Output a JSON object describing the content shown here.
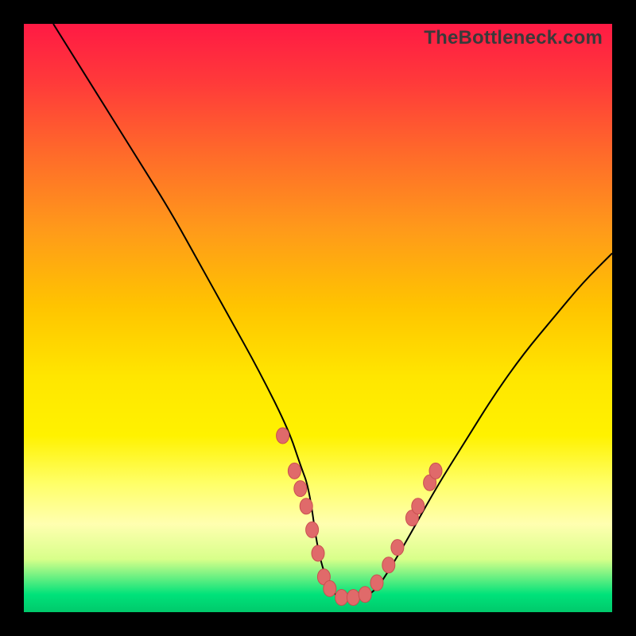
{
  "watermark": "TheBottleneck.com",
  "chart_data": {
    "type": "line",
    "title": "",
    "xlabel": "",
    "ylabel": "",
    "xlim": [
      0,
      100
    ],
    "ylim": [
      0,
      100
    ],
    "series": [
      {
        "name": "curve",
        "x": [
          5,
          10,
          15,
          20,
          25,
          30,
          35,
          40,
          45,
          47,
          48.5,
          50,
          52,
          54,
          56,
          58,
          60,
          62,
          65,
          70,
          75,
          80,
          85,
          90,
          95,
          100
        ],
        "values": [
          100,
          92,
          84,
          76,
          68,
          59,
          50,
          41,
          31,
          25,
          21,
          10,
          4,
          2,
          2,
          2.5,
          4,
          7,
          12,
          21,
          29,
          37,
          44,
          50,
          56,
          61
        ]
      }
    ],
    "markers": [
      {
        "x": 44,
        "value": 30
      },
      {
        "x": 46,
        "value": 24
      },
      {
        "x": 47,
        "value": 21
      },
      {
        "x": 48,
        "value": 18
      },
      {
        "x": 49,
        "value": 14
      },
      {
        "x": 50,
        "value": 10
      },
      {
        "x": 51,
        "value": 6
      },
      {
        "x": 52,
        "value": 4
      },
      {
        "x": 54,
        "value": 2.5
      },
      {
        "x": 56,
        "value": 2.5
      },
      {
        "x": 58,
        "value": 3
      },
      {
        "x": 60,
        "value": 5
      },
      {
        "x": 62,
        "value": 8
      },
      {
        "x": 63.5,
        "value": 11
      },
      {
        "x": 66,
        "value": 16
      },
      {
        "x": 67,
        "value": 18
      },
      {
        "x": 69,
        "value": 22
      },
      {
        "x": 70,
        "value": 24
      }
    ],
    "colors": {
      "curve": "#000000",
      "marker_fill": "#e06a6a",
      "marker_stroke": "#c94f4f"
    }
  }
}
